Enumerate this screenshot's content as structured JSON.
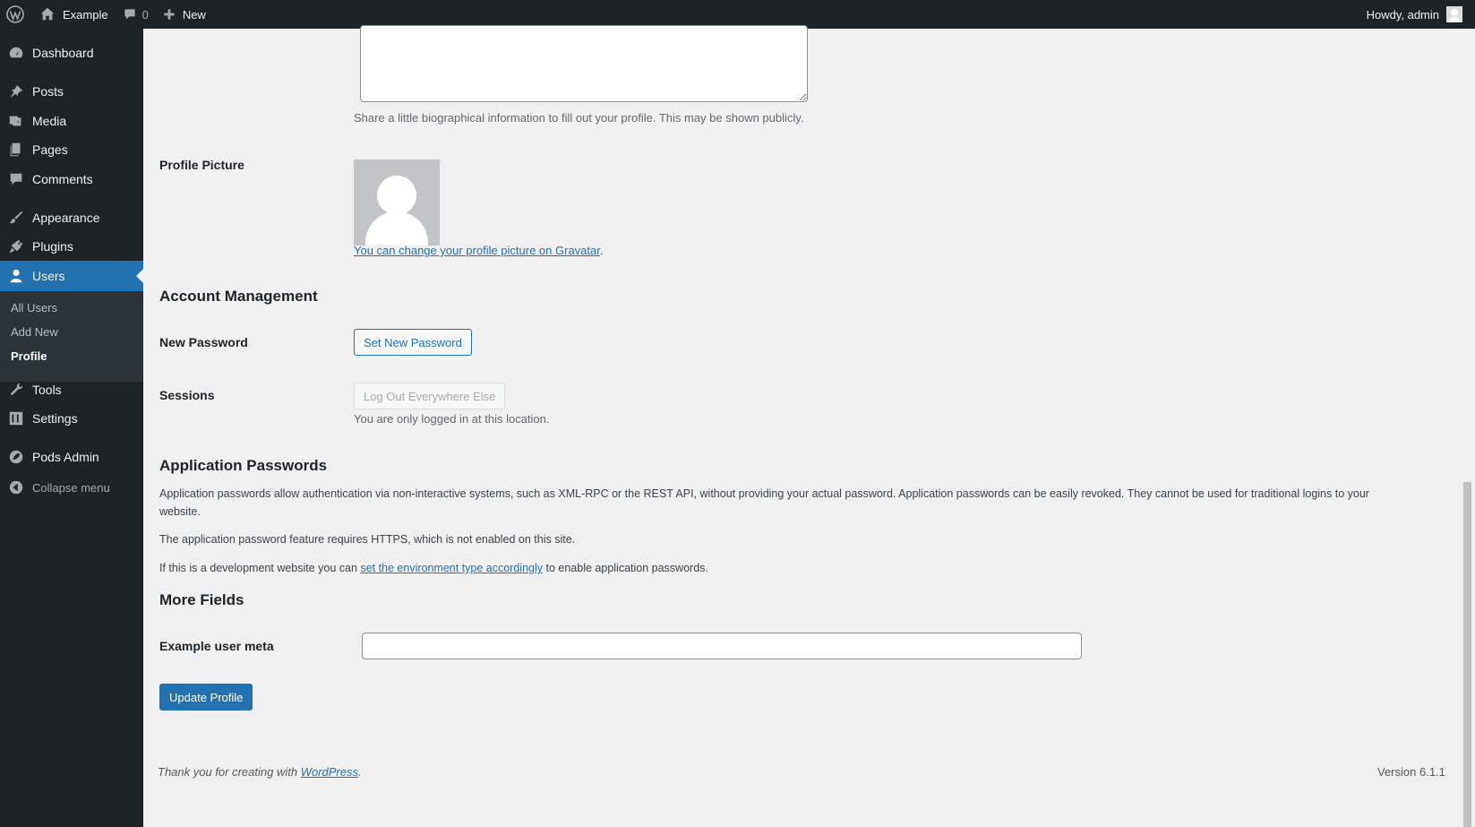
{
  "adminbar": {
    "site_name": "Example",
    "comment_count": "0",
    "new_label": "New",
    "howdy": "Howdy, admin"
  },
  "sidebar": {
    "items": [
      {
        "label": "Dashboard",
        "icon": "dashboard-icon"
      },
      {
        "label": "Posts",
        "icon": "pin-icon"
      },
      {
        "label": "Media",
        "icon": "media-icon"
      },
      {
        "label": "Pages",
        "icon": "pages-icon"
      },
      {
        "label": "Comments",
        "icon": "comment-icon"
      },
      {
        "label": "Appearance",
        "icon": "brush-icon"
      },
      {
        "label": "Plugins",
        "icon": "plugin-icon"
      },
      {
        "label": "Users",
        "icon": "user-icon"
      },
      {
        "label": "Tools",
        "icon": "wrench-icon"
      },
      {
        "label": "Settings",
        "icon": "settings-icon"
      },
      {
        "label": "Pods Admin",
        "icon": "pods-icon"
      }
    ],
    "submenu": [
      "All Users",
      "Add New",
      "Profile"
    ],
    "collapse_label": "Collapse menu"
  },
  "profile": {
    "bio_description": "Share a little biographical information to fill out your profile. This may be shown publicly.",
    "picture_label": "Profile Picture",
    "gravatar_link": "You can change your profile picture on Gravatar",
    "gravatar_suffix": "."
  },
  "account": {
    "heading": "Account Management",
    "new_password_label": "New Password",
    "set_password_button": "Set New Password",
    "sessions_label": "Sessions",
    "logout_button": "Log Out Everywhere Else",
    "sessions_description": "You are only logged in at this location."
  },
  "app_passwords": {
    "heading": "Application Passwords",
    "para1_line1": "Application passwords allow authentication via non-interactive systems, such as XML-RPC or the REST API, without providing your actual password. Application passwords can be easily revoked. They cannot be used for traditional logins to your",
    "para1_line2": "website.",
    "para2": "The application password feature requires HTTPS, which is not enabled on this site.",
    "para3_prefix": "If this is a development website you can ",
    "para3_link": "set the environment type accordingly",
    "para3_suffix": " to enable application passwords."
  },
  "more_fields": {
    "heading": "More Fields",
    "meta_label": "Example user meta",
    "meta_value": ""
  },
  "update_button": "Update Profile",
  "footer": {
    "thanks_prefix": "Thank you for creating with ",
    "thanks_link": "WordPress",
    "thanks_suffix": ".",
    "version": "Version 6.1.1"
  },
  "colors": {
    "admin_bar": "#1d2327",
    "accent": "#2271b1",
    "background": "#f0f0f1"
  }
}
